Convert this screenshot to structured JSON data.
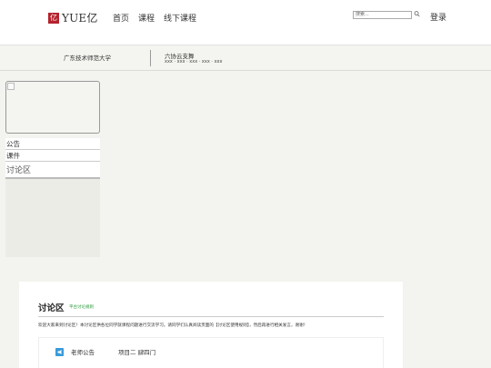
{
  "header": {
    "logo_mark": "亿",
    "logo_text": "YUE亿",
    "nav": [
      "首页",
      "课程",
      "线下课程"
    ],
    "search_placeholder": "搜索...",
    "login": "登录"
  },
  "course": {
    "school": "广东技术师范大学",
    "title": "六协云支舞",
    "subtitle": "xxx · xxx · xxx · xxx · xxx"
  },
  "sidebar": {
    "items": [
      "公告",
      "课件",
      "讨论区"
    ]
  },
  "discussion": {
    "title": "讨论区",
    "rules_link": "平台讨论规则",
    "welcome": "欢迎大家来到讨论区！本讨论区供各位同学就课程问题进行交流学习。请同学们认真阅读页面的【讨论区使用规则】，然后再进行相关发言，谢谢！",
    "notice_label": "老师公告",
    "notice_text": "项目二 肆四门"
  },
  "colors": {
    "logo_red": "#b5222e",
    "link_green": "#2a9a3a",
    "icon_blue": "#3a9ad9"
  }
}
